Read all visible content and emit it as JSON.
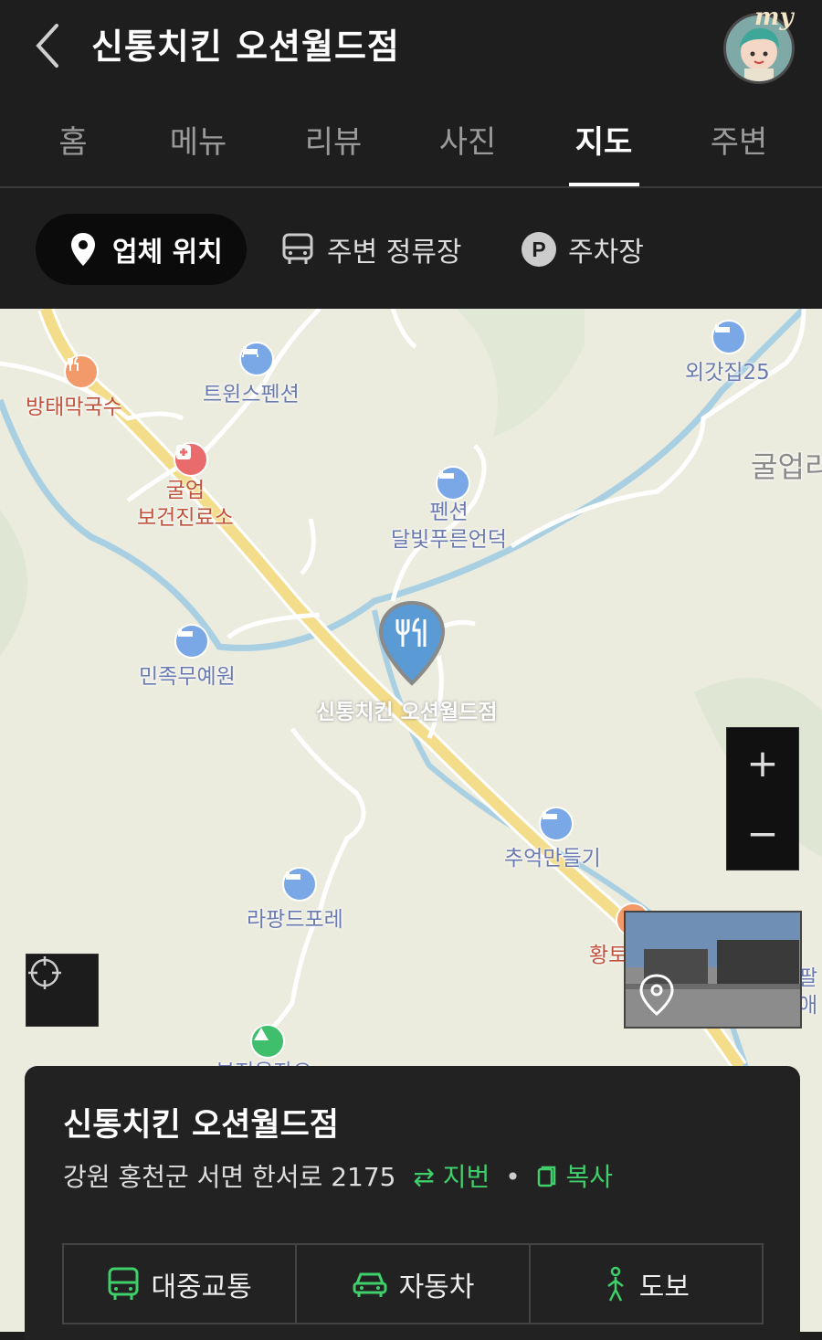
{
  "header": {
    "title": "신통치킨 오션월드점",
    "avatar_badge": "my"
  },
  "tabs": [
    {
      "label": "홈"
    },
    {
      "label": "메뉴"
    },
    {
      "label": "리뷰"
    },
    {
      "label": "사진"
    },
    {
      "label": "지도",
      "active": true
    },
    {
      "label": "주변"
    }
  ],
  "chips": {
    "location": "업체 위치",
    "stops": "주변 정류장",
    "parking": "주차장"
  },
  "map": {
    "labels": {
      "bangtae": "방태막국수",
      "twins": "트윈스펜션",
      "clinic": "굴업\n보건진료소",
      "pension": "펜션\n달빛푸른언덕",
      "oegat": "외갓집25",
      "gulup": "굴업리",
      "minjok": "민족무예원",
      "store": "신통치킨 오션월드점",
      "chueok": "추억만들기",
      "rapang": "라팡드포레",
      "hwang": "황토",
      "pal": "팔\n애",
      "camp": "부지옹자오"
    },
    "zoom_in": "+",
    "zoom_out": "−"
  },
  "panel": {
    "name": "신통치킨 오션월드점",
    "address": "강원 홍천군 서면 한서로 2175",
    "jibun": "지번",
    "copy": "복사",
    "separator": "•",
    "buttons": {
      "transit": "대중교통",
      "car": "자동차",
      "walk": "도보"
    }
  },
  "colors": {
    "accent": "#3fcf6b",
    "pin": "#5b9bd5",
    "road": "#f3dc8a",
    "water": "#9cc8de"
  }
}
